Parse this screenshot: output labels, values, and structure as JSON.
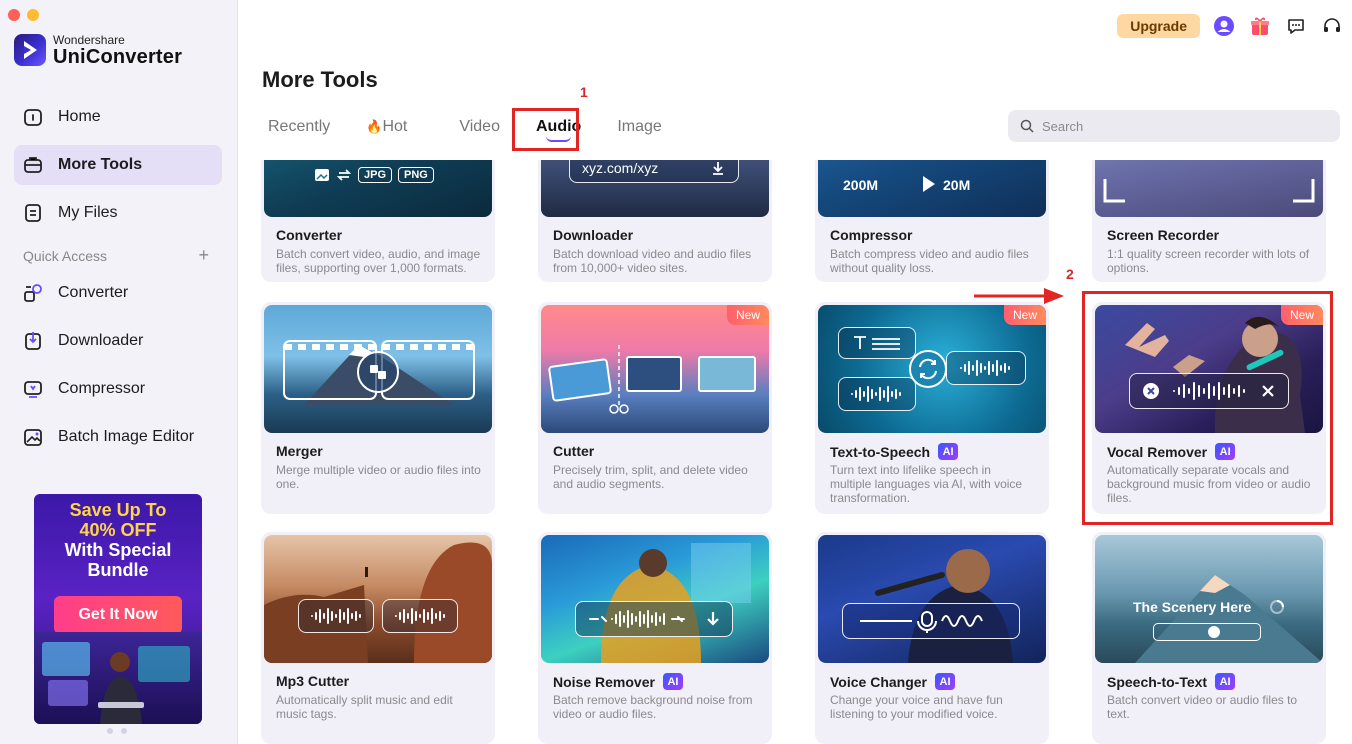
{
  "app": {
    "brand_small": "Wondershare",
    "brand_name": "UniConverter"
  },
  "sidebar": {
    "nav": [
      {
        "label": "Home",
        "icon": "home-icon"
      },
      {
        "label": "More Tools",
        "icon": "toolbox-icon",
        "active": true
      },
      {
        "label": "My Files",
        "icon": "file-icon"
      }
    ],
    "quick_access_label": "Quick Access",
    "quick_access_add": "+",
    "quick_items": [
      {
        "label": "Converter",
        "icon": "converter-icon"
      },
      {
        "label": "Downloader",
        "icon": "downloader-icon"
      },
      {
        "label": "Compressor",
        "icon": "compressor-icon"
      },
      {
        "label": "Batch Image Editor",
        "icon": "image-editor-icon"
      }
    ],
    "promo": {
      "line1": "Save Up To",
      "line2": "40% OFF",
      "line3": "With Special",
      "line4": "Bundle",
      "cta": "Get It Now"
    }
  },
  "topbar": {
    "upgrade": "Upgrade"
  },
  "page": {
    "title": "More Tools"
  },
  "tabs": [
    {
      "label": "Recently"
    },
    {
      "label": "Hot",
      "emoji": "🔥"
    },
    {
      "label": "Video"
    },
    {
      "label": "Audio",
      "active": true
    },
    {
      "label": "Image"
    }
  ],
  "search": {
    "placeholder": "Search"
  },
  "annotations": {
    "step1": "1",
    "step2": "2"
  },
  "cards": [
    {
      "title": "Converter",
      "desc": "Batch convert video, audio, and image files, supporting over 1,000 formats.",
      "thumb": {
        "badges": [
          "JPG",
          "PNG"
        ]
      }
    },
    {
      "title": "Downloader",
      "desc": "Batch download video and audio files from 10,000+ video sites.",
      "thumb": {
        "url": "xyz.com/xyz"
      }
    },
    {
      "title": "Compressor",
      "desc": "Batch compress video and audio files without quality loss.",
      "thumb": {
        "from": "200M",
        "to": "20M"
      }
    },
    {
      "title": "Screen Recorder",
      "desc": "1:1 quality screen recorder with lots of options."
    },
    {
      "title": "Merger",
      "desc": "Merge multiple video or audio files into one."
    },
    {
      "title": "Cutter",
      "desc": "Precisely trim, split, and delete video and audio segments.",
      "badge": "New"
    },
    {
      "title": "Text-to-Speech",
      "desc": "Turn text into lifelike speech in multiple languages via AI, with voice transformation.",
      "badge": "New",
      "ai": "AI"
    },
    {
      "title": "Vocal Remover",
      "desc": "Automatically separate vocals and background music from video or audio files.",
      "badge": "New",
      "ai": "AI"
    },
    {
      "title": "Mp3 Cutter",
      "desc": "Automatically split music and edit music tags."
    },
    {
      "title": "Noise Remover",
      "desc": "Batch remove background noise from video or audio files.",
      "ai": "AI"
    },
    {
      "title": "Voice Changer",
      "desc": "Change your voice and have fun listening to your modified voice.",
      "ai": "AI"
    },
    {
      "title": "Speech-to-Text",
      "desc": "Batch convert video or audio files to text.",
      "ai": "AI",
      "thumb": {
        "caption": "The Scenery Here"
      }
    }
  ]
}
